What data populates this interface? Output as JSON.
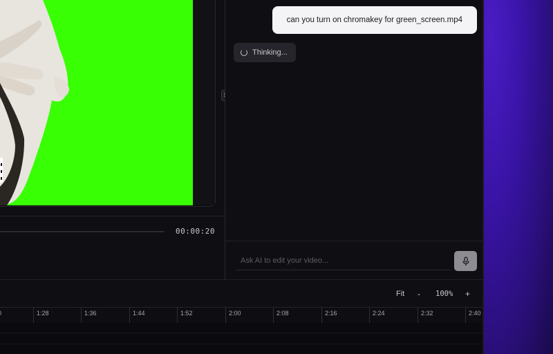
{
  "chat": {
    "user_message": "can you turn on chromakey for green_screen.mp4",
    "status_text": "Thinking...",
    "input_placeholder": "Ask AI to edit your video..."
  },
  "player": {
    "timecode": "00:00:20"
  },
  "timeline": {
    "zoom_fit_label": "Fit",
    "zoom_minus_label": "-",
    "zoom_level": "100%",
    "zoom_plus_label": "+",
    "ruler_ticks": [
      "0",
      "1:28",
      "1:36",
      "1:44",
      "1:52",
      "2:00",
      "2:08",
      "2:16",
      "2:24",
      "2:32",
      "2:40"
    ]
  },
  "colors": {
    "chroma_green": "#39ff05",
    "background": "#0f0e12",
    "accent_purple": "#3a14a8"
  },
  "icons": {
    "spinner": "loading-spinner-icon",
    "mic": "microphone-icon",
    "handle": "drag-handle-icon"
  }
}
